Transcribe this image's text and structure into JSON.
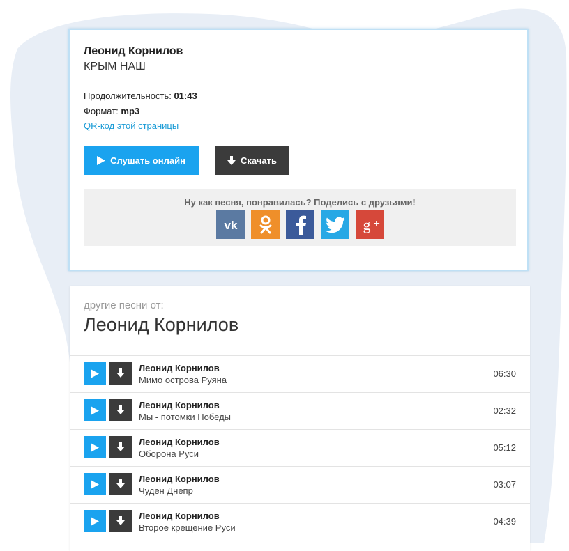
{
  "song": {
    "artist": "Леонид Корнилов",
    "title": "КРЫМ НАШ",
    "duration_label": "Продолжительность:",
    "duration_value": "01:43",
    "format_label": "Формат:",
    "format_value": "mp3",
    "qr_link": "QR-код этой страницы",
    "listen_button": "Слушать онлайн",
    "download_button": "Скачать"
  },
  "share": {
    "text": "Ну как песня, понравилась? Поделись с друзьями!",
    "networks": [
      "vk-icon",
      "odnoklassniki-icon",
      "facebook-icon",
      "twitter-icon",
      "google-plus-icon"
    ]
  },
  "other": {
    "label": "другие песни от:",
    "artist": "Леонид Корнилов",
    "tracks": [
      {
        "artist": "Леонид Корнилов",
        "title": "Мимо острова Руяна",
        "duration": "06:30"
      },
      {
        "artist": "Леонид Корнилов",
        "title": "Мы - потомки Победы",
        "duration": "02:32"
      },
      {
        "artist": "Леонид Корнилов",
        "title": "Оборона Руси",
        "duration": "05:12"
      },
      {
        "artist": "Леонид Корнилов",
        "title": "Чуден Днепр",
        "duration": "03:07"
      },
      {
        "artist": "Леонид Корнилов",
        "title": "Второе крещение Руси",
        "duration": "04:39"
      }
    ]
  },
  "colors": {
    "accent_blue": "#1aa3ef",
    "dark_button": "#3b3b3b",
    "link": "#1a9bd6",
    "vk": "#5b7aa2",
    "ok": "#ef8f2a",
    "facebook": "#3b5a9a",
    "twitter": "#27a8e5",
    "google_plus": "#d6483a"
  }
}
